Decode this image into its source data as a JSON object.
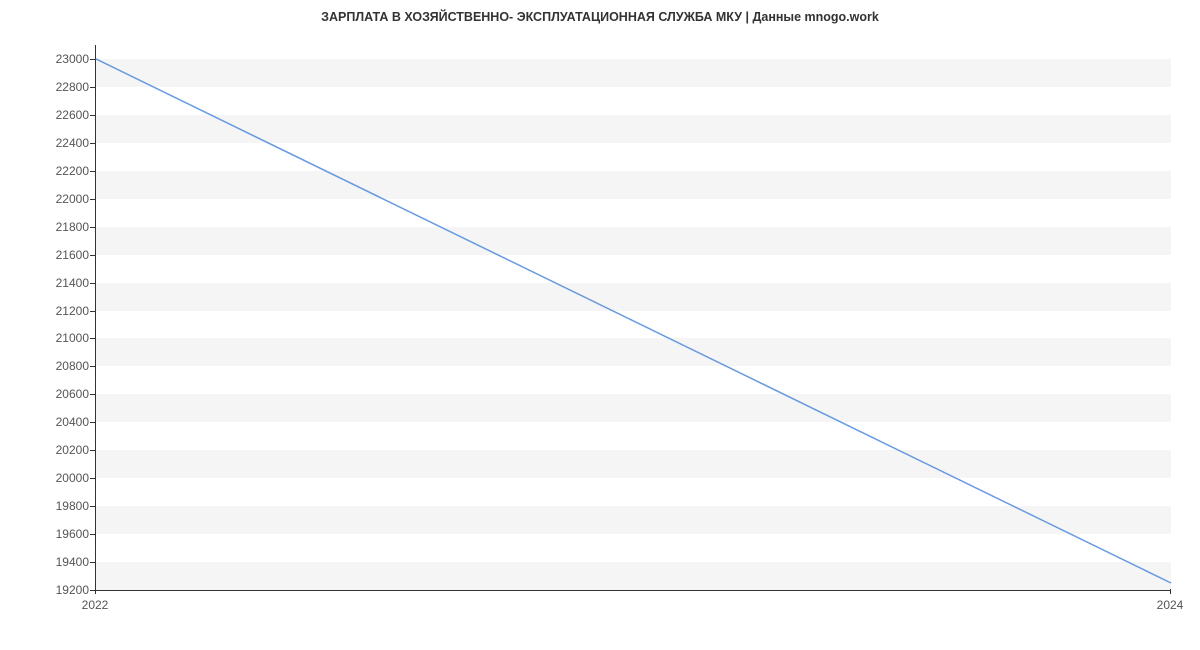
{
  "chart_data": {
    "type": "line",
    "title": "ЗАРПЛАТА В ХОЗЯЙСТВЕННО- ЭКСПЛУАТАЦИОННАЯ СЛУЖБА МКУ | Данные mnogo.work",
    "xlabel": "",
    "ylabel": "",
    "x": [
      2022,
      2024
    ],
    "x_ticks": [
      2022,
      2024
    ],
    "y_ticks": [
      19200,
      19400,
      19600,
      19800,
      20000,
      20200,
      20400,
      20600,
      20800,
      21000,
      21200,
      21400,
      21600,
      21800,
      22000,
      22200,
      22400,
      22600,
      22800,
      23000
    ],
    "ylim": [
      19200,
      23100
    ],
    "series": [
      {
        "name": "salary",
        "values": [
          23000,
          19250
        ],
        "color": "#6699e0"
      }
    ]
  }
}
